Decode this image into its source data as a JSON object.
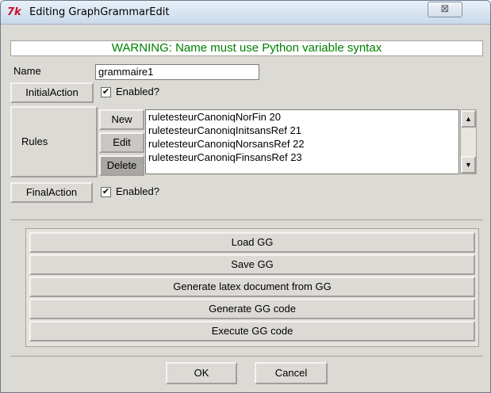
{
  "window": {
    "title": "Editing GraphGrammarEdit",
    "logo_text": "7k",
    "close_glyph": "⊠"
  },
  "warning": "WARNING: Name must use Python variable syntax",
  "name_field": {
    "label": "Name",
    "value": "grammaire1"
  },
  "initial_action": {
    "button": "InitialAction",
    "checkbox_label": "Enabled?",
    "checked": true
  },
  "rules": {
    "label": "Rules",
    "buttons": {
      "new": "New",
      "edit": "Edit",
      "delete": "Delete"
    },
    "items": [
      "ruletesteurCanoniqNorFin 20",
      "ruletesteurCanoniqInitsansRef 21",
      "ruletesteurCanoniqNorsansRef 22",
      "ruletesteurCanoniqFinsansRef 23"
    ]
  },
  "final_action": {
    "button": "FinalAction",
    "checkbox_label": "Enabled?",
    "checked": true
  },
  "actions": {
    "load": "Load GG",
    "save": "Save GG",
    "latex": "Generate latex document from GG",
    "gen_code": "Generate GG code",
    "exec_code": "Execute GG code"
  },
  "footer": {
    "ok": "OK",
    "cancel": "Cancel"
  },
  "colors": {
    "warning_text": "#008000",
    "tk_logo": "#c8102e",
    "dialog_bg": "#dcdad5"
  },
  "icons": {
    "check": "✔",
    "scroll_up": "▲",
    "scroll_down": "▼"
  }
}
